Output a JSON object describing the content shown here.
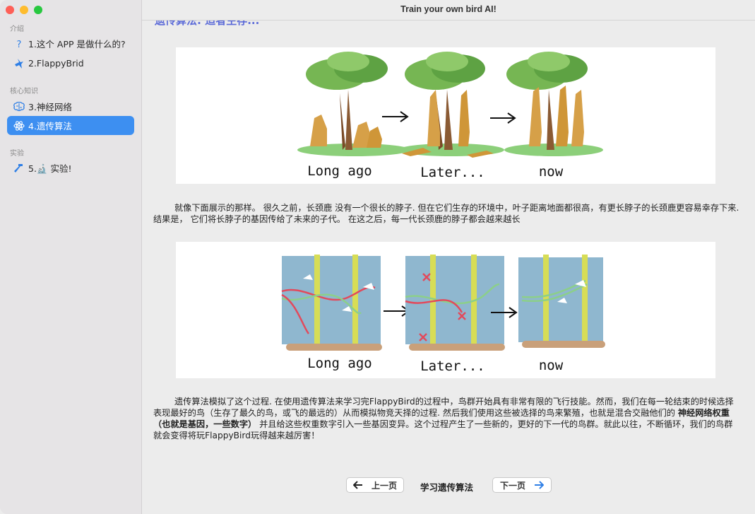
{
  "window": {
    "title": "Train your own bird AI!"
  },
  "sidebar": {
    "sections": [
      {
        "title": "介绍",
        "items": [
          {
            "label": "1.这个 APP 是做什么的?",
            "icon": "question-mark-icon"
          },
          {
            "label": "2.FlappyBrid",
            "icon": "bird-icon"
          }
        ]
      },
      {
        "title": "核心知识",
        "items": [
          {
            "label": "3.神经网络",
            "icon": "brain-icon"
          },
          {
            "label": "4.遗传算法",
            "icon": "atom-icon",
            "active": true
          }
        ]
      },
      {
        "title": "实验",
        "items": [
          {
            "label": "5.🔬 实验!",
            "icon": "hammer-icon"
          }
        ]
      }
    ]
  },
  "main": {
    "heading": "遗传算法: 适者生存...",
    "figure1": {
      "captions": [
        "Long ago",
        "Later...",
        "now"
      ]
    },
    "paragraph1": "就像下面展示的那样。 很久之前，长颈鹿 没有一个很长的脖子. 但在它们生存的环境中，叶子距离地面都很高，有更长脖子的长颈鹿更容易幸存下来. 结果是， 它们将长脖子的基因传给了未来的子代。 在这之后，每一代长颈鹿的脖子都会越来越长",
    "figure2": {
      "captions": [
        "Long ago",
        "Later...",
        "now"
      ]
    },
    "paragraph2_part1": "遗传算法模拟了这个过程. 在使用遗传算法来学习完FlappyBird的过程中，鸟群开始具有非常有限的飞行技能。然而，我们在每一轮结束的时候选择表现最好的鸟（生存了最久的鸟，或飞的最远的）从而模拟物竞天择的过程. 然后我们使用这些被选择的鸟来繁殖，也就是混合交融他们的 ",
    "paragraph2_bold": "神经网络权重（也就是基因，一些数字）",
    "paragraph2_part2": " 并且给这些权重数字引入一些基因变异。这个过程产生了一些新的，更好的下一代的鸟群。就此以往，不断循环，我们的鸟群就会变得将玩FlappyBird玩得越来越厉害！"
  },
  "pager": {
    "prev_label": "上一页",
    "current_label": "学习遗传算法",
    "next_label": "下一页"
  }
}
